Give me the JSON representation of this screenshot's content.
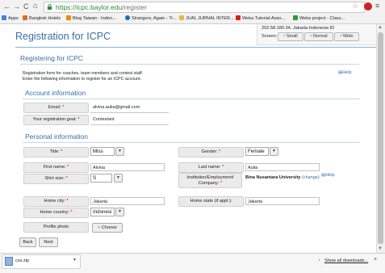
{
  "browser": {
    "url_host": "https://icpc.baylor.edu",
    "url_path": "/register",
    "bookmarks": [
      {
        "label": "Apps",
        "color": "#4a7de0"
      },
      {
        "label": "Bangkok Hotels",
        "color": "#e06a2a"
      },
      {
        "label": "Blog Taiwan - Indon...",
        "color": "#f08a00"
      },
      {
        "label": "Strangers, Again - Tr...",
        "color": "#1a6bb5"
      },
      {
        "label": "JUAL JURNAL INTER...",
        "color": "#e8b84a"
      },
      {
        "label": "Weka Tutorial-Asso...",
        "color": "#d62020"
      },
      {
        "label": "Weka project - Class...",
        "color": "#2a9a3a"
      }
    ]
  },
  "page": {
    "title": "Registration for ICPC",
    "ip": "202.58.180.34, Jakarta Indonesia ID",
    "screen_label": "Screen:",
    "screen_buttons": [
      "Small",
      "Normal",
      "Wide"
    ],
    "heading": "Registering for ICPC",
    "intro_line1": "Registration form for coaches, team members and contest staff.",
    "intro_line2": "Enter the following information to register for an ICPC account.",
    "help": "Help",
    "account_section": "Account information",
    "email_label": "Email:",
    "email_value": "alvina.aulia@gmail.com",
    "goal_label": "Your registration goal:",
    "goal_value": "Contestant",
    "personal_section": "Personal information",
    "title_label": "Title:",
    "title_value": "Miss",
    "gender_label": "Gender:",
    "gender_value": "Female",
    "first_label": "First name:",
    "first_value": "Alvina",
    "last_label": "Last name:",
    "last_value": "Aulia",
    "shirt_label": "Shirt size:",
    "shirt_value": "S",
    "inst_label_1": "Institution/Employment/",
    "inst_label_2": "Company:",
    "inst_value": "Bina Nusantara University",
    "inst_change": "(change)",
    "inst_help": "Help",
    "city_label": "Home city:",
    "city_value": "Jakarta",
    "state_label": "Home state (if appl.):",
    "state_value": "Jakarta",
    "country_label": "Home country:",
    "country_value": "Indonesi",
    "photo_label": "Profile photo",
    "choose_label": "Choose",
    "back_label": "Back",
    "next_label": "Next",
    "required_mark": "*"
  },
  "download": {
    "filename": "css.zip",
    "show_all": "Show all downloads..."
  }
}
